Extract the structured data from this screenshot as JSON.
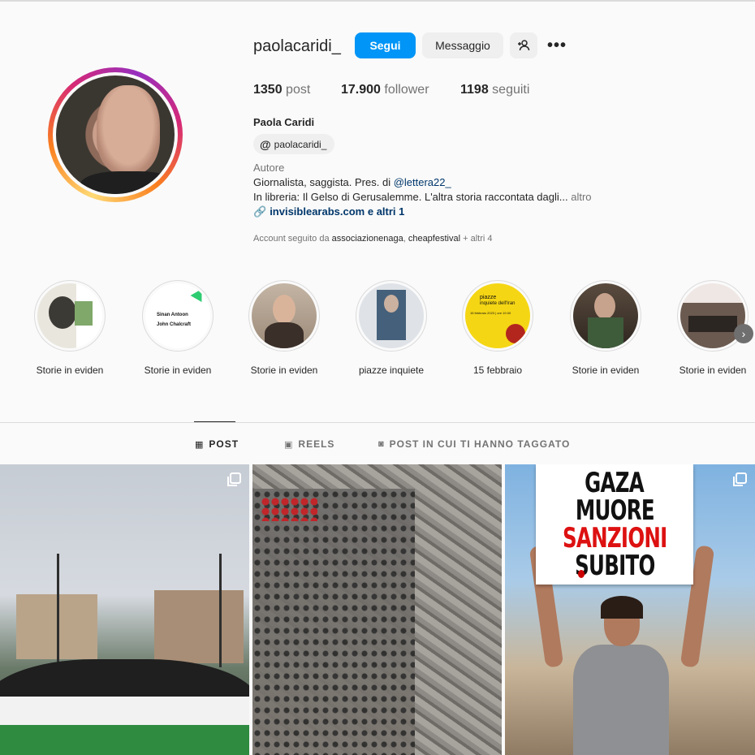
{
  "profile": {
    "username": "paolacaridi_",
    "follow_label": "Segui",
    "message_label": "Messaggio",
    "stats": {
      "posts_count": "1350",
      "posts_label": "post",
      "followers_count": "17.900",
      "followers_label": "follower",
      "following_count": "1198",
      "following_label": "seguiti"
    },
    "full_name": "Paola Caridi",
    "threads_handle": "paolacaridi_",
    "category": "Autore",
    "bio_line1_prefix": "Giornalista, saggista. Pres. di ",
    "bio_mention": "@lettera22_",
    "bio_line2": "In libreria: Il Gelso di Gerusalemme. L'altra storia raccontata dagli...",
    "bio_more": "altro",
    "link_text": "invisiblearabs.com e altri 1",
    "followed_by_prefix": "Account seguito da ",
    "followed_by_account1": "associazionenaga",
    "followed_by_sep": ", ",
    "followed_by_account2": "cheapfestival",
    "followed_by_suffix": " + altri 4"
  },
  "highlights": [
    {
      "label": "Storie in eviden"
    },
    {
      "label": "Storie in eviden",
      "text1": "Sinan Antoon",
      "text2": "John Chalcraft"
    },
    {
      "label": "Storie in eviden"
    },
    {
      "label": "piazze inquiete"
    },
    {
      "label": "15 febbraio",
      "text1": "piazze",
      "text2": "inquiete dell'Iran",
      "text3": "15 febbraio 2023 | ore 19.00"
    },
    {
      "label": "Storie in eviden"
    },
    {
      "label": "Storie in eviden"
    }
  ],
  "tabs": [
    {
      "label": "POST",
      "icon": "grid-icon",
      "active": true
    },
    {
      "label": "REELS",
      "icon": "reels-icon",
      "active": false
    },
    {
      "label": "POST IN CUI TI HANNO TAGGATO",
      "icon": "tagged-icon",
      "active": false
    }
  ],
  "posts": [
    {
      "kind": "photo",
      "multi": true
    },
    {
      "kind": "photo",
      "multi": false
    },
    {
      "kind": "photo",
      "multi": true,
      "sign_lines": [
        "GAZA",
        "MUORE",
        "SANZIONI",
        "SUBITO"
      ]
    }
  ],
  "colors": {
    "accent": "#0095f6",
    "link": "#00376b",
    "secondary_text": "#737373"
  }
}
